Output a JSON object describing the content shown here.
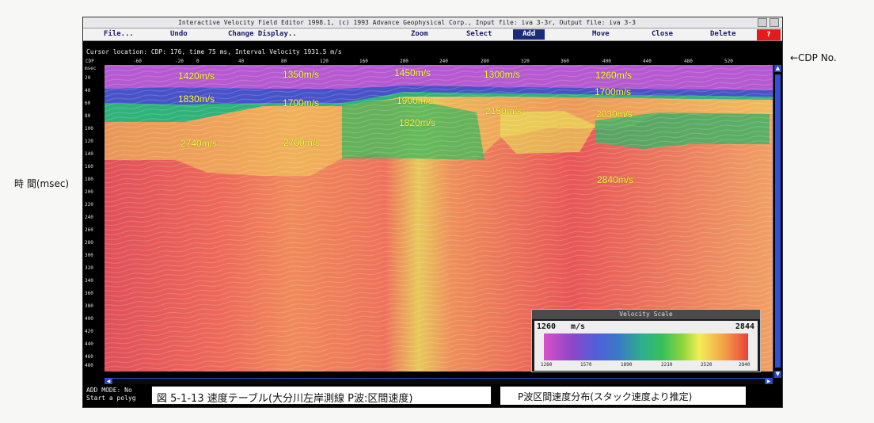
{
  "annotations": {
    "cdp_no": "←CDP No.",
    "time_label": "時 間(msec)"
  },
  "window": {
    "title": "Interactive Velocity Field Editor 1998.1, (c) 1993 Advance Geophysical Corp., Input file: iva 3-3r, Output file: iva 3-3"
  },
  "menu": {
    "items": [
      "File...",
      "Undo",
      "Change Display..",
      "Zoom",
      "Select",
      "Add",
      "Move",
      "Close",
      "Delete"
    ],
    "active": "Add",
    "help": "?"
  },
  "status": {
    "cursor": "Cursor location: CDP: 176, time 75 ms, Interval Velocity 1931.5 m/s"
  },
  "axes": {
    "cdp_name": "CDP",
    "cdp_ticks": [
      "-60",
      "-20",
      "0",
      "40",
      "80",
      "120",
      "160",
      "200",
      "240",
      "280",
      "320",
      "360",
      "400",
      "440",
      "480",
      "520"
    ],
    "time_name": "msec",
    "time_ticks": [
      "20",
      "40",
      "60",
      "80",
      "100",
      "120",
      "140",
      "160",
      "180",
      "200",
      "220",
      "240",
      "260",
      "280",
      "300",
      "320",
      "340",
      "360",
      "380",
      "400",
      "420",
      "440",
      "460",
      "480",
      "500"
    ]
  },
  "velocity_labels": [
    "1420m/s",
    "1350m/s",
    "1450m/s",
    "1300m/s",
    "1260m/s",
    "1830m/s",
    "1700m/s",
    "1900m/s",
    "1700m/s",
    "2150m/s",
    "1820m/s",
    "2030m/s",
    "2740m/s",
    "2700m/s",
    "2840m/s"
  ],
  "velocity_scale": {
    "title": "Velocity Scale",
    "min": "1260",
    "max": "2844",
    "unit": "m/s",
    "ticks": [
      "1260",
      "1570",
      "1890",
      "2210",
      "2520",
      "2840"
    ]
  },
  "mode": {
    "line1": "ADD MODE: No",
    "line2": "Start a polyg"
  },
  "captions": {
    "figure": "図 5-1-13 速度テーブル(大分川左岸測線 P波:区間速度)",
    "sub": "P波区間速度分布(スタック速度より推定)"
  },
  "colors": {
    "purple": "#b64fd0",
    "blue": "#4a4fd0",
    "green": "#2ab070",
    "yellow": "#e7e65a",
    "red": "#e8535a",
    "label": "#ffff30",
    "active_menu": "#1b2b7a",
    "help_button": "#e51b1b"
  }
}
